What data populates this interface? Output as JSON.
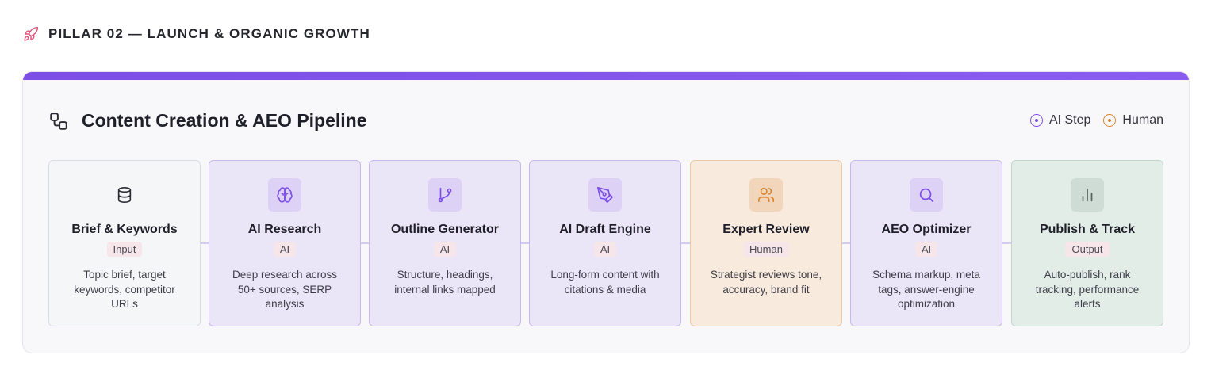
{
  "pillar": {
    "title": "PILLAR 02 — LAUNCH & ORGANIC GROWTH",
    "icon": "rocket-icon"
  },
  "card": {
    "title": "Content Creation & AEO Pipeline",
    "icon": "workflow-icon",
    "accent_color": "#7d4ee6"
  },
  "legend": [
    {
      "label": "AI Step",
      "color": "#7d4ee6"
    },
    {
      "label": "Human",
      "color": "#d9852e"
    }
  ],
  "steps": [
    {
      "title": "Brief & Keywords",
      "badge": "Input",
      "kind": "input",
      "icon": "database-icon",
      "description": "Topic brief, target keywords, competitor URLs"
    },
    {
      "title": "AI Research",
      "badge": "AI",
      "kind": "ai",
      "icon": "brain-icon",
      "description": "Deep research across 50+ sources, SERP analysis"
    },
    {
      "title": "Outline Generator",
      "badge": "AI",
      "kind": "ai",
      "icon": "git-branch-icon",
      "description": "Structure, headings, internal links mapped"
    },
    {
      "title": "AI Draft Engine",
      "badge": "AI",
      "kind": "ai",
      "icon": "pen-tool-icon",
      "description": "Long-form content with citations & media"
    },
    {
      "title": "Expert Review",
      "badge": "Human",
      "kind": "human",
      "icon": "users-icon",
      "description": "Strategist reviews tone, accuracy, brand fit"
    },
    {
      "title": "AEO Optimizer",
      "badge": "AI",
      "kind": "ai",
      "icon": "search-icon",
      "description": "Schema markup, meta tags, answer-engine optimization"
    },
    {
      "title": "Publish & Track",
      "badge": "Output",
      "kind": "output",
      "icon": "bar-chart-icon",
      "description": "Auto-publish, rank tracking, performance alerts"
    }
  ]
}
